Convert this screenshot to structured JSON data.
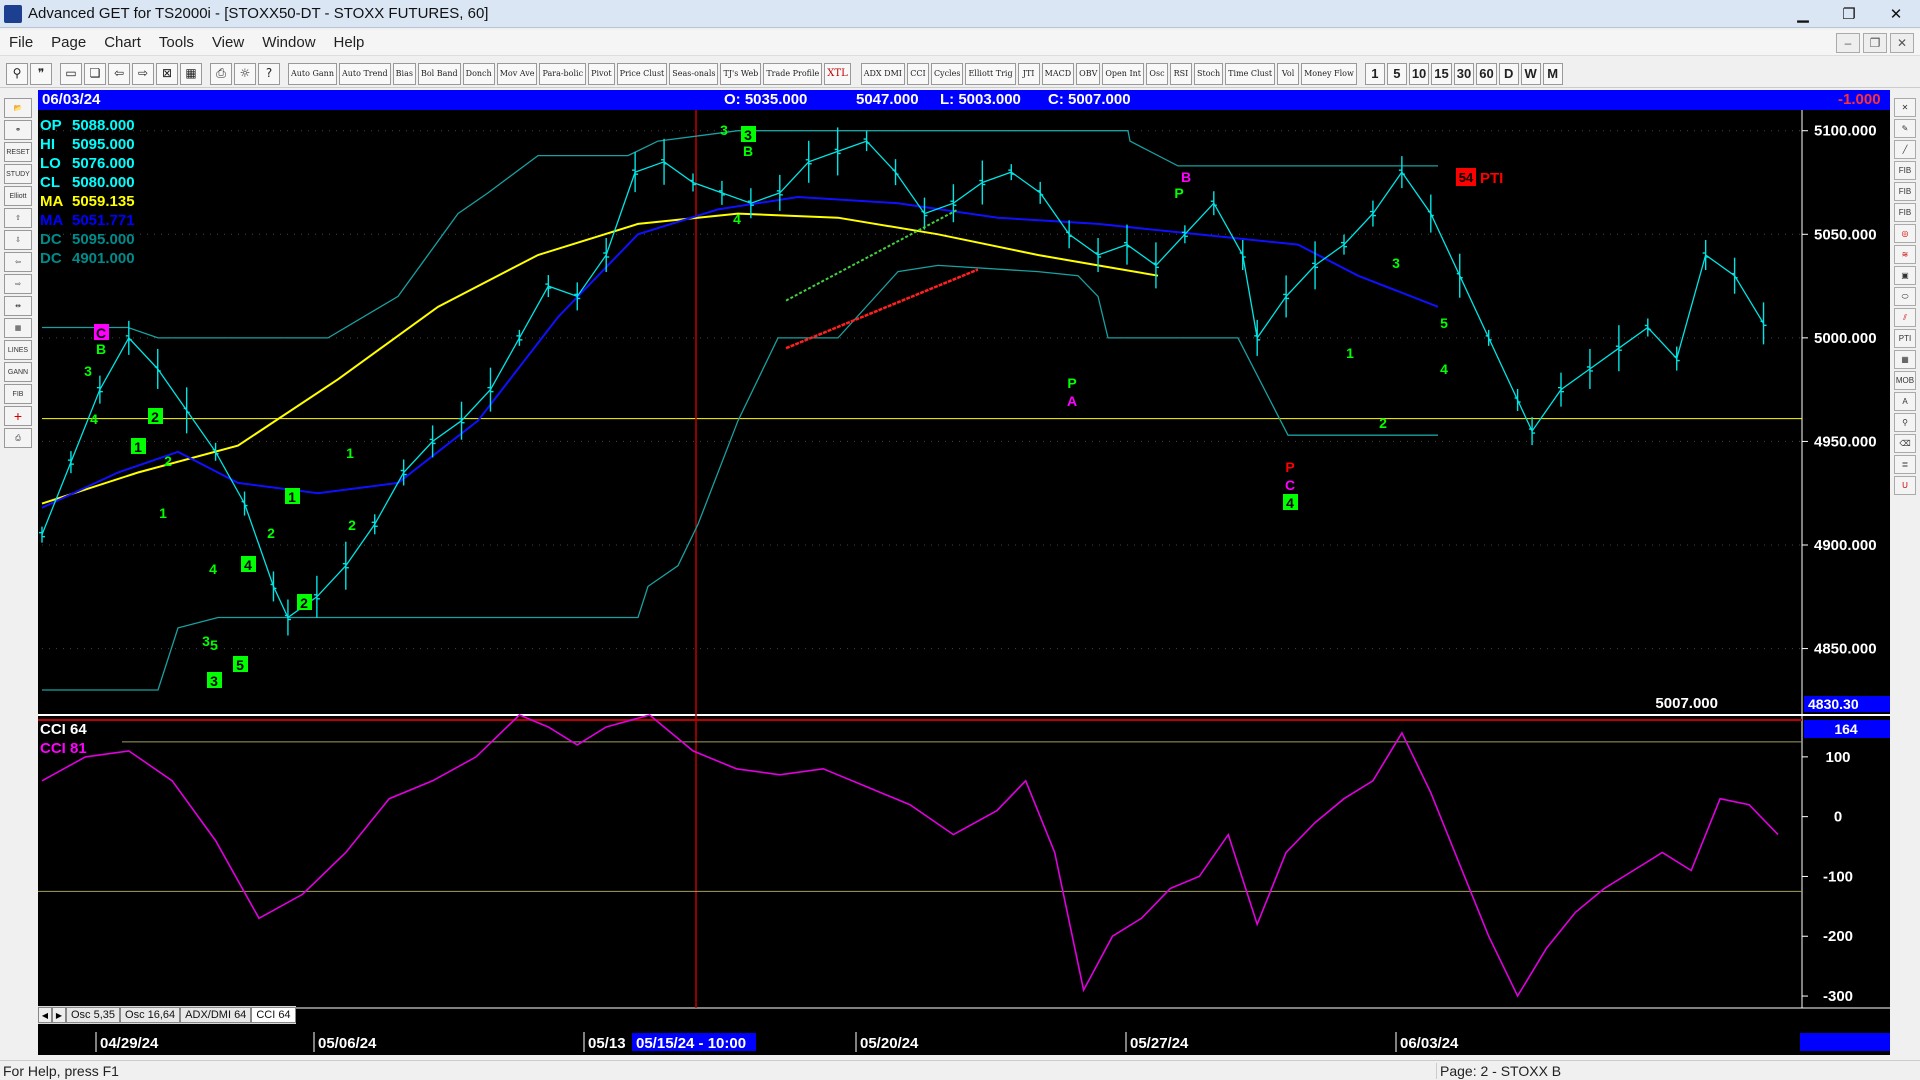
{
  "window": {
    "title": "Advanced GET for TS2000i - [STOXX50-DT - STOXX FUTURES, 60]",
    "minimize": "▁",
    "restore": "❐",
    "close": "✕"
  },
  "menu": [
    "File",
    "Page",
    "Chart",
    "Tools",
    "View",
    "Window",
    "Help"
  ],
  "toolbar": {
    "studies": [
      "Auto Gann",
      "Auto Trend",
      "Bias",
      "Bol Band",
      "Donch",
      "Mov Ave",
      "Para-bolic",
      "Pivot",
      "Price Clust",
      "Seas-onals",
      "TJ's Web",
      "Trade Profile",
      "XTL",
      "ADX DMI",
      "CCI",
      "Cycles",
      "Elliott Trig",
      "JTI",
      "MACD",
      "OBV",
      "Open Int",
      "Osc",
      "RSI",
      "Stoch",
      "Time Clust",
      "Vol",
      "Money Flow"
    ],
    "timeframes": [
      "1",
      "5",
      "10",
      "15",
      "30",
      "60",
      "D",
      "W",
      "M"
    ]
  },
  "infobar": {
    "date": "06/03/24",
    "open": "O: 5035.000",
    "high": "5047.000",
    "low": "L: 5003.000",
    "close": "C: 5007.000",
    "change": "-1.000"
  },
  "legend": [
    {
      "label": "OP",
      "value": "5088.000",
      "color": "#00ffff"
    },
    {
      "label": "HI",
      "value": "5095.000",
      "color": "#00ffff"
    },
    {
      "label": "LO",
      "value": "5076.000",
      "color": "#00ffff"
    },
    {
      "label": "CL",
      "value": "5080.000",
      "color": "#00ffff"
    },
    {
      "label": "MA",
      "value": "5059.135",
      "color": "#ffff00"
    },
    {
      "label": "MA",
      "value": "5051.771",
      "color": "#0000ff"
    },
    {
      "label": "DC",
      "value": "5095.000",
      "color": "#008b8b"
    },
    {
      "label": "DC",
      "value": "4901.000",
      "color": "#008b8b"
    }
  ],
  "price_axis": {
    "ticks": [
      "5100.000",
      "5050.000",
      "5000.000",
      "4950.000",
      "4900.000",
      "4850.000"
    ],
    "last_price": "5007.000",
    "cursor_price": "4830.30"
  },
  "pti": {
    "value": "54",
    "label": "PTI"
  },
  "cci": {
    "title": "CCI 64",
    "value_label": "CCI  81",
    "current": "164",
    "ticks": [
      "100",
      "0",
      "-100",
      "-200",
      "-300"
    ]
  },
  "date_axis": {
    "labels": [
      "04/29/24",
      "05/06/24",
      "05/13",
      "05/20/24",
      "05/27/24",
      "06/03/24"
    ],
    "cursor": "05/15/24 - 10:00"
  },
  "tabs": [
    "Osc 5,35",
    "Osc 16,64",
    "ADX/DMI 64",
    "CCI 64"
  ],
  "elliott_labels": [
    {
      "t": "3",
      "c": "#00ff00",
      "box": false
    },
    {
      "t": "3",
      "c": "#00ff00",
      "box": true
    },
    {
      "t": "B",
      "c": "#00ff00",
      "box": false
    },
    {
      "t": "4",
      "c": "#00ff00",
      "box": false
    },
    {
      "t": "C",
      "c": "#ff00ff",
      "box": true
    },
    {
      "t": "B",
      "c": "#00ff00",
      "box": false
    },
    {
      "t": "3",
      "c": "#00ff00",
      "box": false
    },
    {
      "t": "4",
      "c": "#00ff00",
      "box": false
    },
    {
      "t": "2",
      "c": "#00ff00",
      "box": true
    },
    {
      "t": "1",
      "c": "#00ff00",
      "box": true
    },
    {
      "t": "2",
      "c": "#00ff00",
      "box": false
    },
    {
      "t": "1",
      "c": "#00ff00",
      "box": false
    },
    {
      "t": "2",
      "c": "#00ff00",
      "box": false
    },
    {
      "t": "4",
      "c": "#00ff00",
      "box": false
    },
    {
      "t": "4",
      "c": "#00ff00",
      "box": true
    },
    {
      "t": "1",
      "c": "#00ff00",
      "box": true
    },
    {
      "t": "1",
      "c": "#00ff00",
      "box": false
    },
    {
      "t": "2",
      "c": "#00ff00",
      "box": false
    },
    {
      "t": "2",
      "c": "#00ff00",
      "box": true
    },
    {
      "t": "3",
      "c": "#00ff00",
      "box": false
    },
    {
      "t": "5",
      "c": "#00ff00",
      "box": false
    },
    {
      "t": "5",
      "c": "#00ff00",
      "box": true
    },
    {
      "t": "3",
      "c": "#00ff00",
      "box": true
    },
    {
      "t": "B",
      "c": "#ff00ff",
      "box": false
    },
    {
      "t": "P",
      "c": "#00ff00",
      "box": false
    },
    {
      "t": "P",
      "c": "#00ff00",
      "box": false
    },
    {
      "t": "A",
      "c": "#ff00ff",
      "box": false
    },
    {
      "t": "P",
      "c": "#ff0000",
      "box": false
    },
    {
      "t": "C",
      "c": "#ff00ff",
      "box": false
    },
    {
      "t": "4",
      "c": "#00ff00",
      "box": true
    },
    {
      "t": "1",
      "c": "#00ff00",
      "box": false
    },
    {
      "t": "2",
      "c": "#00ff00",
      "box": false
    },
    {
      "t": "3",
      "c": "#00ff00",
      "box": false
    },
    {
      "t": "5",
      "c": "#00ff00",
      "box": false
    },
    {
      "t": "4",
      "c": "#00ff00",
      "box": false
    }
  ],
  "chart_data": {
    "type": "line",
    "price_series": [
      {
        "d": 0,
        "p": 4905
      },
      {
        "d": 2,
        "p": 4940
      },
      {
        "d": 4,
        "p": 4975
      },
      {
        "d": 6,
        "p": 5000
      },
      {
        "d": 8,
        "p": 4985
      },
      {
        "d": 10,
        "p": 4965
      },
      {
        "d": 12,
        "p": 4945
      },
      {
        "d": 14,
        "p": 4920
      },
      {
        "d": 16,
        "p": 4880
      },
      {
        "d": 17,
        "p": 4865
      },
      {
        "d": 19,
        "p": 4875
      },
      {
        "d": 21,
        "p": 4890
      },
      {
        "d": 23,
        "p": 4910
      },
      {
        "d": 25,
        "p": 4935
      },
      {
        "d": 27,
        "p": 4950
      },
      {
        "d": 29,
        "p": 4960
      },
      {
        "d": 31,
        "p": 4975
      },
      {
        "d": 33,
        "p": 5000
      },
      {
        "d": 35,
        "p": 5025
      },
      {
        "d": 37,
        "p": 5020
      },
      {
        "d": 39,
        "p": 5040
      },
      {
        "d": 41,
        "p": 5080
      },
      {
        "d": 43,
        "p": 5085
      },
      {
        "d": 45,
        "p": 5075
      },
      {
        "d": 47,
        "p": 5070
      },
      {
        "d": 49,
        "p": 5065
      },
      {
        "d": 51,
        "p": 5070
      },
      {
        "d": 53,
        "p": 5085
      },
      {
        "d": 55,
        "p": 5090
      },
      {
        "d": 57,
        "p": 5095
      },
      {
        "d": 59,
        "p": 5080
      },
      {
        "d": 61,
        "p": 5060
      },
      {
        "d": 63,
        "p": 5065
      },
      {
        "d": 65,
        "p": 5075
      },
      {
        "d": 67,
        "p": 5080
      },
      {
        "d": 69,
        "p": 5070
      },
      {
        "d": 71,
        "p": 5050
      },
      {
        "d": 73,
        "p": 5040
      },
      {
        "d": 75,
        "p": 5045
      },
      {
        "d": 77,
        "p": 5035
      },
      {
        "d": 79,
        "p": 5050
      },
      {
        "d": 81,
        "p": 5065
      },
      {
        "d": 83,
        "p": 5040
      },
      {
        "d": 84,
        "p": 5000
      },
      {
        "d": 86,
        "p": 5020
      },
      {
        "d": 88,
        "p": 5035
      },
      {
        "d": 90,
        "p": 5045
      },
      {
        "d": 92,
        "p": 5060
      },
      {
        "d": 94,
        "p": 5080
      },
      {
        "d": 96,
        "p": 5060
      },
      {
        "d": 98,
        "p": 5030
      },
      {
        "d": 100,
        "p": 5000
      },
      {
        "d": 102,
        "p": 4970
      },
      {
        "d": 103,
        "p": 4955
      },
      {
        "d": 105,
        "p": 4975
      },
      {
        "d": 107,
        "p": 4985
      },
      {
        "d": 109,
        "p": 4995
      },
      {
        "d": 111,
        "p": 5005
      },
      {
        "d": 113,
        "p": 4990
      },
      {
        "d": 115,
        "p": 5040
      },
      {
        "d": 117,
        "p": 5030
      },
      {
        "d": 119,
        "p": 5007
      }
    ],
    "cci_series": [
      {
        "d": 0,
        "v": 60
      },
      {
        "d": 3,
        "v": 100
      },
      {
        "d": 6,
        "v": 110
      },
      {
        "d": 9,
        "v": 60
      },
      {
        "d": 12,
        "v": -40
      },
      {
        "d": 15,
        "v": -170
      },
      {
        "d": 18,
        "v": -130
      },
      {
        "d": 21,
        "v": -60
      },
      {
        "d": 24,
        "v": 30
      },
      {
        "d": 27,
        "v": 60
      },
      {
        "d": 30,
        "v": 100
      },
      {
        "d": 33,
        "v": 170
      },
      {
        "d": 35,
        "v": 150
      },
      {
        "d": 37,
        "v": 120
      },
      {
        "d": 39,
        "v": 150
      },
      {
        "d": 42,
        "v": 170
      },
      {
        "d": 45,
        "v": 110
      },
      {
        "d": 48,
        "v": 80
      },
      {
        "d": 51,
        "v": 70
      },
      {
        "d": 54,
        "v": 80
      },
      {
        "d": 57,
        "v": 50
      },
      {
        "d": 60,
        "v": 20
      },
      {
        "d": 63,
        "v": -30
      },
      {
        "d": 66,
        "v": 10
      },
      {
        "d": 68,
        "v": 60
      },
      {
        "d": 70,
        "v": -60
      },
      {
        "d": 72,
        "v": -290
      },
      {
        "d": 74,
        "v": -200
      },
      {
        "d": 76,
        "v": -170
      },
      {
        "d": 78,
        "v": -120
      },
      {
        "d": 80,
        "v": -100
      },
      {
        "d": 82,
        "v": -30
      },
      {
        "d": 84,
        "v": -180
      },
      {
        "d": 86,
        "v": -60
      },
      {
        "d": 88,
        "v": -10
      },
      {
        "d": 90,
        "v": 30
      },
      {
        "d": 92,
        "v": 60
      },
      {
        "d": 94,
        "v": 140
      },
      {
        "d": 96,
        "v": 40
      },
      {
        "d": 98,
        "v": -80
      },
      {
        "d": 100,
        "v": -200
      },
      {
        "d": 102,
        "v": -300
      },
      {
        "d": 104,
        "v": -220
      },
      {
        "d": 106,
        "v": -160
      },
      {
        "d": 108,
        "v": -120
      },
      {
        "d": 110,
        "v": -90
      },
      {
        "d": 112,
        "v": -60
      },
      {
        "d": 114,
        "v": -90
      },
      {
        "d": 116,
        "v": 30
      },
      {
        "d": 118,
        "v": 20
      },
      {
        "d": 120,
        "v": -30
      }
    ],
    "ylim": [
      4830,
      5110
    ],
    "cci_ylim": [
      -320,
      170
    ]
  },
  "status": {
    "help": "For Help, press F1",
    "page": "Page: 2 - STOXX B"
  }
}
